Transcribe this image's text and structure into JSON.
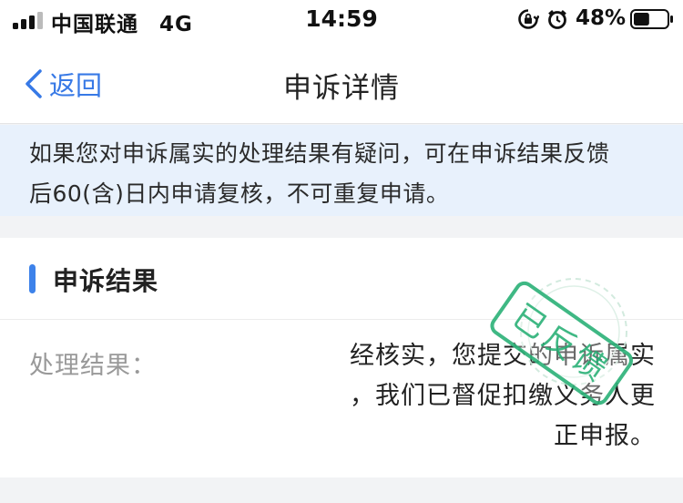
{
  "status_bar": {
    "carrier": "中国联通",
    "network": "4G",
    "time": "14:59",
    "battery": "48%",
    "battery_level": 0.48
  },
  "nav": {
    "back_label": "返回",
    "title": "申诉详情"
  },
  "notice": {
    "line1": "如果您对申诉属实的处理结果有疑问，可在申诉结果反馈",
    "line2": "后60(含)日内申请复核，不可重复申请。"
  },
  "result": {
    "section_title": "申诉结果",
    "label": "处理结果：",
    "value_line1": "经核实，您提交的申诉属实",
    "value_line2": "，我们已督促扣缴义务人更",
    "value_line3": "正申报。",
    "stamp_text": "已反馈",
    "stamp_color": "#2fb37a"
  },
  "colors": {
    "accent": "#3779e6",
    "notice_bg": "#e8f1fc",
    "page_bg": "#f2f3f5"
  }
}
